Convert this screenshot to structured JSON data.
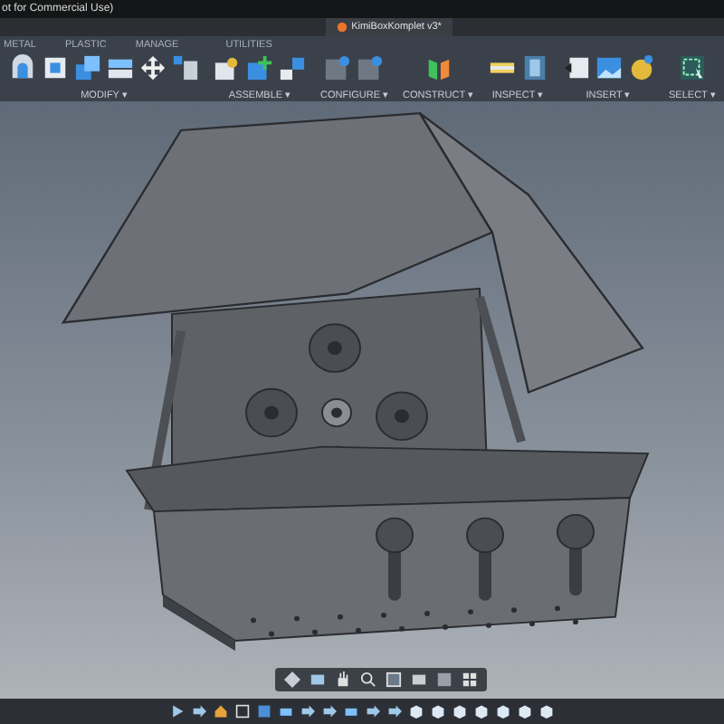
{
  "window": {
    "title": "ot for Commercial Use)"
  },
  "document_tab": {
    "title": "KimiBoxKomplet v3*"
  },
  "toolbar": {
    "tabs": [
      "METAL",
      "PLASTIC",
      "MANAGE",
      "UTILITIES"
    ],
    "groups": [
      {
        "label": "MODIFY ▾"
      },
      {
        "label": "ASSEMBLE ▾"
      },
      {
        "label": "CONFIGURE ▾"
      },
      {
        "label": "CONSTRUCT ▾"
      },
      {
        "label": "INSPECT ▾"
      },
      {
        "label": "INSERT ▾"
      },
      {
        "label": "SELECT ▾"
      }
    ]
  }
}
